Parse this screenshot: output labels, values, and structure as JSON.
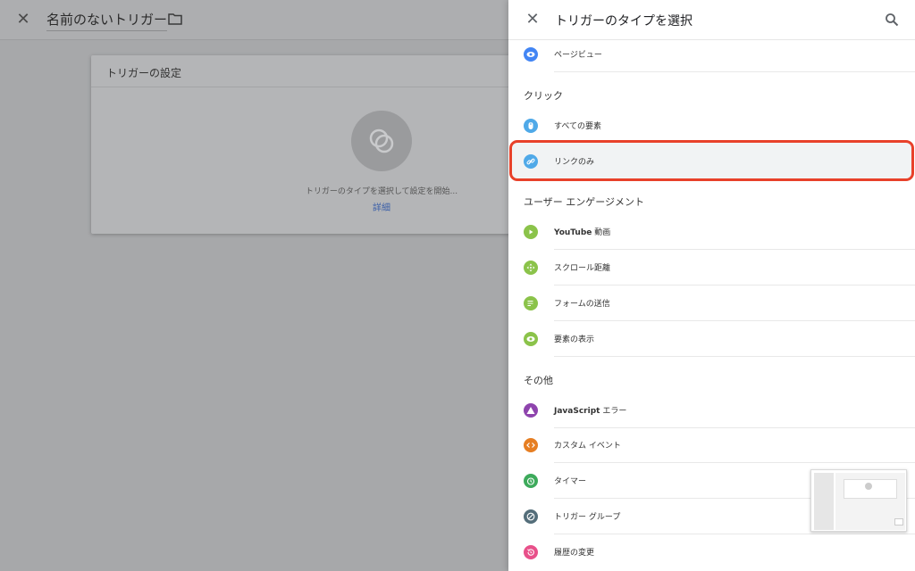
{
  "editor": {
    "title": "名前のないトリガー",
    "card_title": "トリガーの設定",
    "hint": "トリガーのタイプを選択して設定を開始...",
    "details_link": "詳細"
  },
  "panel": {
    "title": "トリガーのタイプを選択",
    "top_item": {
      "label": "ページビュー",
      "icon": "eye-icon",
      "color": "#4285f4"
    },
    "sections": [
      {
        "title": "クリック",
        "items": [
          {
            "label": "すべての要素",
            "icon": "mouse-icon",
            "color": "#4fa9e8"
          },
          {
            "label": "リンクのみ",
            "icon": "link-icon",
            "color": "#4fa9e8",
            "highlighted": true
          }
        ]
      },
      {
        "title": "ユーザー エンゲージメント",
        "items": [
          {
            "label_bold": "YouTube",
            "label": " 動画",
            "icon": "play-icon",
            "color": "#8bc34a"
          },
          {
            "label": "スクロール距離",
            "icon": "move-icon",
            "color": "#8bc34a"
          },
          {
            "label": "フォームの送信",
            "icon": "form-icon",
            "color": "#8bc34a"
          },
          {
            "label": "要素の表示",
            "icon": "eye-icon",
            "color": "#8bc34a"
          }
        ]
      },
      {
        "title": "その他",
        "items": [
          {
            "label_bold": "JavaScript",
            "label": " エラー",
            "icon": "warning-icon",
            "color": "#8e44ad"
          },
          {
            "label": "カスタム イベント",
            "icon": "code-icon",
            "color": "#e67e22"
          },
          {
            "label": "タイマー",
            "icon": "alarm-icon",
            "color": "#3daa5b"
          },
          {
            "label": "トリガー グループ",
            "icon": "group-icon",
            "color": "#546e7a"
          },
          {
            "label": "履歴の変更",
            "icon": "history-icon",
            "color": "#e8508a"
          }
        ]
      }
    ]
  }
}
